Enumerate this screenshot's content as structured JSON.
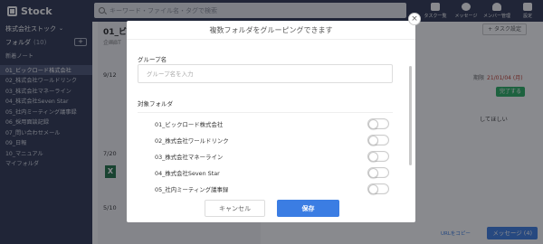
{
  "app": {
    "logo_text": "Stock",
    "search_placeholder": "キーワード・ファイル名・タグで検索",
    "nav": [
      {
        "label": "タスク一覧",
        "icon": "check-icon"
      },
      {
        "label": "メッセージ",
        "icon": "message-icon"
      },
      {
        "label": "メンバー管理",
        "icon": "members-icon"
      },
      {
        "label": "設定",
        "icon": "gear-icon"
      }
    ]
  },
  "sidebar": {
    "company": "株式会社ストック",
    "folder_header": "フォルダ",
    "folder_count": "(10)",
    "add_label": "+",
    "new_note": "新着ノート",
    "items": [
      "01_ビックロード株式会社",
      "02_株式会社ワールドリンク",
      "03_株式会社マネーライン",
      "04_株式会社Seven Star",
      "05_社内ミーティング議事録",
      "06_採用面談記録",
      "07_問い合わせメール",
      "09_日報",
      "10_マニュアル",
      "マイフォルダ"
    ]
  },
  "list": {
    "title": "01_ビ",
    "subtitle": "企画BT",
    "dates": [
      "9/12",
      "7/20",
      "5/10"
    ],
    "date_suffix": "日"
  },
  "content": {
    "task_button": "+ タスク設定",
    "deadline_label": "期限",
    "deadline_value": "21/01/04 (月)",
    "done_button": "完了する",
    "text_snippet": "してほしい",
    "message_button": "メッセージ (4)",
    "url_copy": "URLをコピー",
    "card_footer": "2/8 (月) 14:58"
  },
  "modal": {
    "title": "複数フォルダをグルーピングできます",
    "group_name_label": "グループ名",
    "group_name_placeholder": "グループ名を入力",
    "group_name_value": "",
    "target_folders_label": "対象フォルダ",
    "folders": [
      {
        "name": "01_ビックロード株式会社",
        "on": false
      },
      {
        "name": "02_株式会社ワールドリンク",
        "on": false
      },
      {
        "name": "03_株式会社マネーライン",
        "on": false
      },
      {
        "name": "04_株式会社Seven Star",
        "on": false
      },
      {
        "name": "05_社内ミーティング議事録",
        "on": false
      }
    ],
    "cancel_button": "キャンセル",
    "save_button": "保存",
    "close_symbol": "×"
  }
}
